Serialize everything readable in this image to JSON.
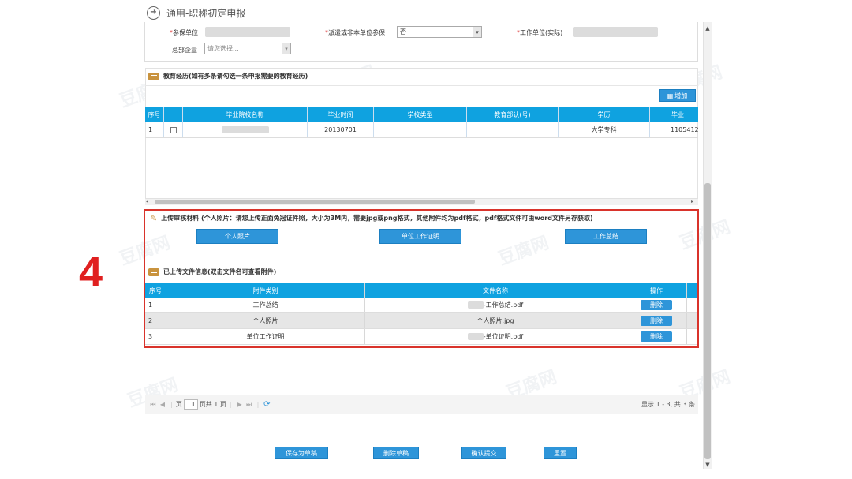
{
  "page": {
    "title": "通用-职称初定申报",
    "annotation_number": "4"
  },
  "form": {
    "insured_unit_label": "参保单位",
    "dispatch_label": "派遣或非本单位参保",
    "dispatch_value": "否",
    "work_unit_label": "工作单位(实际)",
    "hq_label": "总部企业",
    "hq_placeholder": "请您选择..."
  },
  "education": {
    "section_title": "教育经历(如有多条请勾选一条申报需要的教育经历)",
    "add_button": "增加",
    "columns": [
      "序号",
      "毕业院校名称",
      "毕业时间",
      "学校类型",
      "教育部认(号)",
      "学历",
      "毕业"
    ],
    "rows": [
      {
        "no": "1",
        "school": "",
        "grad_date": "20130701",
        "school_type": "",
        "moe_cert": "",
        "degree": "大学专科",
        "cert_no": "1105412"
      }
    ]
  },
  "upload": {
    "section_title": "上传审核材料 (个人照片：请您上传正面免冠证件照，大小为3M内，需要jpg或png格式，其他附件均为pdf格式，pdf格式文件可由word文件另存获取)",
    "buttons": [
      "个人照片",
      "单位工作证明",
      "工作总结"
    ]
  },
  "uploaded": {
    "section_title": "已上传文件信息(双击文件名可查看附件)",
    "columns": [
      "序号",
      "附件类别",
      "文件名称",
      "操作"
    ],
    "rows": [
      {
        "no": "1",
        "category": "工作总结",
        "filename": "-工作总结.pdf",
        "action": "删除"
      },
      {
        "no": "2",
        "category": "个人照片",
        "filename": "个人照片.jpg",
        "action": "删除"
      },
      {
        "no": "3",
        "category": "单位工作证明",
        "filename": "-单位证明.pdf",
        "action": "删除"
      }
    ]
  },
  "pager": {
    "page_label": "页",
    "page_value": "1",
    "total_label": "页共 1 页",
    "display_text": "显示 1 - 3,  共 3 条"
  },
  "actions": {
    "save_draft": "保存为草稿",
    "delete_draft": "删除草稿",
    "confirm_submit": "确认提交",
    "reset": "重置"
  },
  "colors": {
    "header_blue": "#0fa2e0",
    "button_blue": "#2e95d9",
    "highlight_red": "#d9332b"
  },
  "watermark": "豆腐网"
}
